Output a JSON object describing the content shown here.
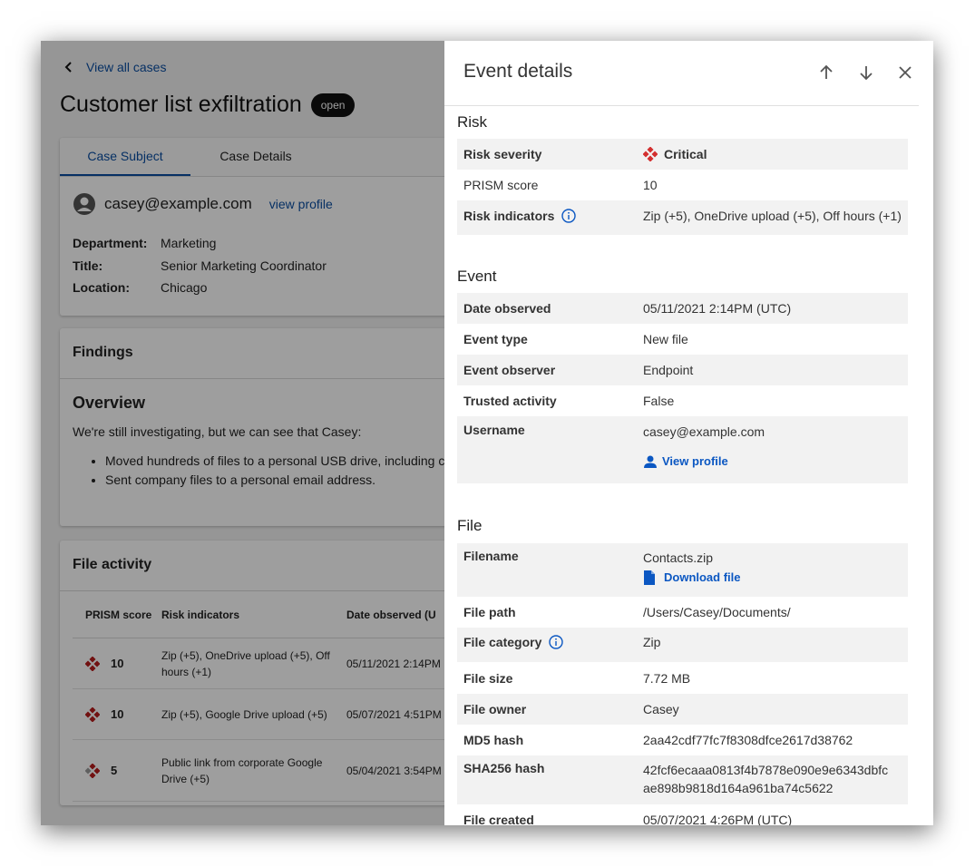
{
  "background": {
    "back_link": "View all cases",
    "title": "Customer list exfiltration",
    "status_badge": "open",
    "tabs": [
      "Case Subject",
      "Case Details"
    ],
    "subject": {
      "email": "casey@example.com",
      "view_profile": "view profile",
      "fields": [
        {
          "label": "Department:",
          "value": "Marketing"
        },
        {
          "label": "Title:",
          "value": "Senior Marketing Coordinator"
        },
        {
          "label": "Location:",
          "value": "Chicago"
        }
      ]
    },
    "findings": {
      "header": "Findings",
      "overview_title": "Overview",
      "intro": "We're still investigating, but we can see that Casey:",
      "bullets": [
        "Moved hundreds of files to a personal USB drive, including c",
        "Sent company files to a personal email address."
      ]
    },
    "activity": {
      "header": "File activity",
      "columns": [
        "PRISM score",
        "Risk indicators",
        "Date observed (U"
      ],
      "rows": [
        {
          "score": "10",
          "indicators": "Zip (+5), OneDrive upload (+5), Off hours (+1)",
          "date": "05/11/2021 2:14PM"
        },
        {
          "score": "10",
          "indicators": "Zip (+5), Google Drive upload (+5)",
          "date": "05/07/2021 4:51PM"
        },
        {
          "score": "5",
          "indicators": "Public link from corporate Google Drive (+5)",
          "date": "05/04/2021 3:54PM"
        }
      ]
    }
  },
  "panel": {
    "title": "Event details",
    "risk": {
      "title": "Risk",
      "severity_label": "Risk severity",
      "severity_value": "Critical",
      "score_label": "PRISM score",
      "score_value": "10",
      "indicators_label": "Risk indicators",
      "indicators_value": "Zip (+5), OneDrive upload (+5), Off hours (+1)"
    },
    "event": {
      "title": "Event",
      "date_label": "Date observed",
      "date_value": "05/11/2021 2:14PM (UTC)",
      "type_label": "Event type",
      "type_value": "New file",
      "observer_label": "Event observer",
      "observer_value": "Endpoint",
      "trusted_label": "Trusted activity",
      "trusted_value": "False",
      "username_label": "Username",
      "username_value": "casey@example.com",
      "view_profile": "View profile"
    },
    "file": {
      "title": "File",
      "filename_label": "Filename",
      "filename_value": "Contacts.zip",
      "download": "Download file",
      "path_label": "File path",
      "path_value": "/Users/Casey/Documents/",
      "category_label": "File category",
      "category_value": "Zip",
      "size_label": "File size",
      "size_value": "7.72 MB",
      "owner_label": "File owner",
      "owner_value": "Casey",
      "md5_label": "MD5 hash",
      "md5_value": "2aa42cdf77fc7f8308dfce2617d38762",
      "sha_label": "SHA256 hash",
      "sha_value_1": "42fcf6ecaaa0813f4b7878e090e9e6343dbfc",
      "sha_value_2": "ae898b9818d164a961ba74c5622",
      "created_label": "File created",
      "created_value": "05/07/2021 4:26PM (UTC)"
    }
  },
  "colors": {
    "accent": "#0b4ea2",
    "critical": "#d32f2f",
    "badge": "#111111"
  }
}
